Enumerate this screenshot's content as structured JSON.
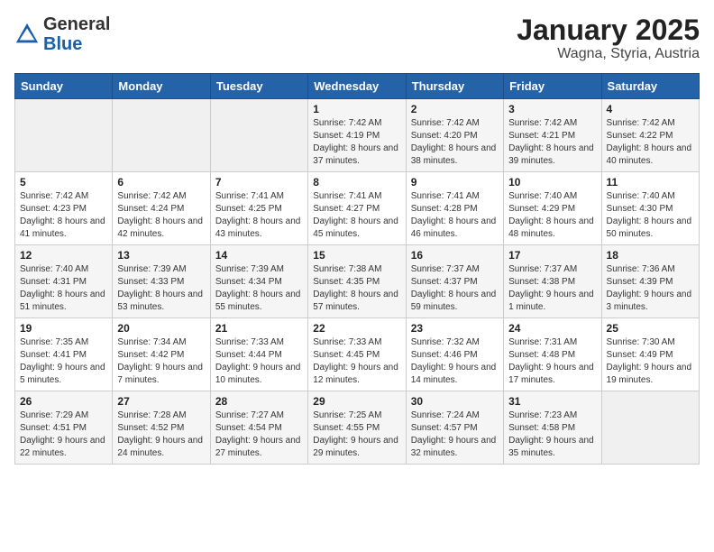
{
  "header": {
    "logo_general": "General",
    "logo_blue": "Blue",
    "title": "January 2025",
    "location": "Wagna, Styria, Austria"
  },
  "days_of_week": [
    "Sunday",
    "Monday",
    "Tuesday",
    "Wednesday",
    "Thursday",
    "Friday",
    "Saturday"
  ],
  "weeks": [
    [
      {
        "day": "",
        "info": ""
      },
      {
        "day": "",
        "info": ""
      },
      {
        "day": "",
        "info": ""
      },
      {
        "day": "1",
        "info": "Sunrise: 7:42 AM\nSunset: 4:19 PM\nDaylight: 8 hours and 37 minutes."
      },
      {
        "day": "2",
        "info": "Sunrise: 7:42 AM\nSunset: 4:20 PM\nDaylight: 8 hours and 38 minutes."
      },
      {
        "day": "3",
        "info": "Sunrise: 7:42 AM\nSunset: 4:21 PM\nDaylight: 8 hours and 39 minutes."
      },
      {
        "day": "4",
        "info": "Sunrise: 7:42 AM\nSunset: 4:22 PM\nDaylight: 8 hours and 40 minutes."
      }
    ],
    [
      {
        "day": "5",
        "info": "Sunrise: 7:42 AM\nSunset: 4:23 PM\nDaylight: 8 hours and 41 minutes."
      },
      {
        "day": "6",
        "info": "Sunrise: 7:42 AM\nSunset: 4:24 PM\nDaylight: 8 hours and 42 minutes."
      },
      {
        "day": "7",
        "info": "Sunrise: 7:41 AM\nSunset: 4:25 PM\nDaylight: 8 hours and 43 minutes."
      },
      {
        "day": "8",
        "info": "Sunrise: 7:41 AM\nSunset: 4:27 PM\nDaylight: 8 hours and 45 minutes."
      },
      {
        "day": "9",
        "info": "Sunrise: 7:41 AM\nSunset: 4:28 PM\nDaylight: 8 hours and 46 minutes."
      },
      {
        "day": "10",
        "info": "Sunrise: 7:40 AM\nSunset: 4:29 PM\nDaylight: 8 hours and 48 minutes."
      },
      {
        "day": "11",
        "info": "Sunrise: 7:40 AM\nSunset: 4:30 PM\nDaylight: 8 hours and 50 minutes."
      }
    ],
    [
      {
        "day": "12",
        "info": "Sunrise: 7:40 AM\nSunset: 4:31 PM\nDaylight: 8 hours and 51 minutes."
      },
      {
        "day": "13",
        "info": "Sunrise: 7:39 AM\nSunset: 4:33 PM\nDaylight: 8 hours and 53 minutes."
      },
      {
        "day": "14",
        "info": "Sunrise: 7:39 AM\nSunset: 4:34 PM\nDaylight: 8 hours and 55 minutes."
      },
      {
        "day": "15",
        "info": "Sunrise: 7:38 AM\nSunset: 4:35 PM\nDaylight: 8 hours and 57 minutes."
      },
      {
        "day": "16",
        "info": "Sunrise: 7:37 AM\nSunset: 4:37 PM\nDaylight: 8 hours and 59 minutes."
      },
      {
        "day": "17",
        "info": "Sunrise: 7:37 AM\nSunset: 4:38 PM\nDaylight: 9 hours and 1 minute."
      },
      {
        "day": "18",
        "info": "Sunrise: 7:36 AM\nSunset: 4:39 PM\nDaylight: 9 hours and 3 minutes."
      }
    ],
    [
      {
        "day": "19",
        "info": "Sunrise: 7:35 AM\nSunset: 4:41 PM\nDaylight: 9 hours and 5 minutes."
      },
      {
        "day": "20",
        "info": "Sunrise: 7:34 AM\nSunset: 4:42 PM\nDaylight: 9 hours and 7 minutes."
      },
      {
        "day": "21",
        "info": "Sunrise: 7:33 AM\nSunset: 4:44 PM\nDaylight: 9 hours and 10 minutes."
      },
      {
        "day": "22",
        "info": "Sunrise: 7:33 AM\nSunset: 4:45 PM\nDaylight: 9 hours and 12 minutes."
      },
      {
        "day": "23",
        "info": "Sunrise: 7:32 AM\nSunset: 4:46 PM\nDaylight: 9 hours and 14 minutes."
      },
      {
        "day": "24",
        "info": "Sunrise: 7:31 AM\nSunset: 4:48 PM\nDaylight: 9 hours and 17 minutes."
      },
      {
        "day": "25",
        "info": "Sunrise: 7:30 AM\nSunset: 4:49 PM\nDaylight: 9 hours and 19 minutes."
      }
    ],
    [
      {
        "day": "26",
        "info": "Sunrise: 7:29 AM\nSunset: 4:51 PM\nDaylight: 9 hours and 22 minutes."
      },
      {
        "day": "27",
        "info": "Sunrise: 7:28 AM\nSunset: 4:52 PM\nDaylight: 9 hours and 24 minutes."
      },
      {
        "day": "28",
        "info": "Sunrise: 7:27 AM\nSunset: 4:54 PM\nDaylight: 9 hours and 27 minutes."
      },
      {
        "day": "29",
        "info": "Sunrise: 7:25 AM\nSunset: 4:55 PM\nDaylight: 9 hours and 29 minutes."
      },
      {
        "day": "30",
        "info": "Sunrise: 7:24 AM\nSunset: 4:57 PM\nDaylight: 9 hours and 32 minutes."
      },
      {
        "day": "31",
        "info": "Sunrise: 7:23 AM\nSunset: 4:58 PM\nDaylight: 9 hours and 35 minutes."
      },
      {
        "day": "",
        "info": ""
      }
    ]
  ]
}
